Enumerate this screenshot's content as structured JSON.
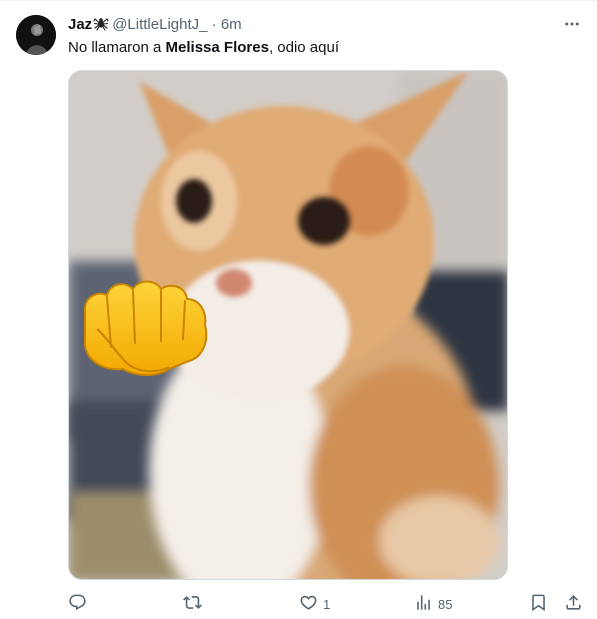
{
  "tweet": {
    "display_name": "Jaz",
    "handle": "@LittleLightJ_",
    "separator": "·",
    "time": "6m",
    "text_before": "No llamaron a ",
    "text_bold": "Melissa Flores",
    "text_after": ", odio aquí",
    "media": {
      "description_icon": "cat-with-fist-emoji-icon"
    }
  },
  "actions": {
    "reply_count": "",
    "retweet_count": "",
    "like_count": "1",
    "views_count": "85"
  },
  "colors": {
    "text": "#0f1419",
    "secondary": "#536471",
    "border": "#cfd9de"
  }
}
